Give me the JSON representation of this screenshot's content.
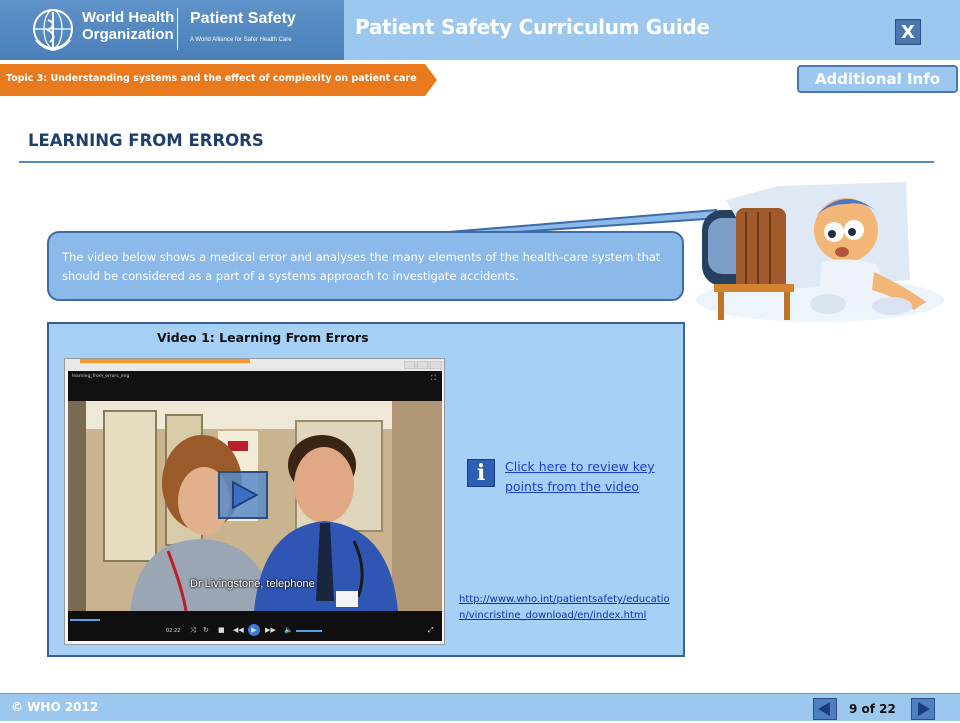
{
  "header": {
    "org_name": "World Health\nOrganization",
    "program_title": "Patient Safety",
    "program_subtitle": "A World Alliance for Safer Health Care",
    "app_title": "Patient Safety Curriculum Guide",
    "close_label": "X"
  },
  "topic": {
    "label": "Topic 3: Understanding systems and the effect of complexity on patient care"
  },
  "additional_info_label": "Additional Info",
  "page": {
    "title": "LEARNING FROM ERRORS",
    "intro": "The video below shows a medical error and analyses the many elements of the health-care system that should be considered as a part of a systems  approach to  investigate accidents."
  },
  "video": {
    "title": "Video 1: Learning From Errors",
    "filename": "learning_from_errors_eng",
    "subtitle": "Dr Livingstone, telephone",
    "time": "02:22",
    "progress": 0.08
  },
  "links": {
    "key_points": "Click here to review key points from the video",
    "url": "http://www.who.int/patientsafety/education/vincristine_download/en/index.html"
  },
  "footer": {
    "copyright": "© WHO 2012",
    "page_indicator": "9 of 22"
  },
  "icons": {
    "info": "info-icon",
    "prev": "arrow-left-icon",
    "next": "arrow-right-icon",
    "play": "play-icon"
  },
  "colors": {
    "header_bg": "#9cc7ee",
    "logo_bg": "#4a7fb8",
    "topic_orange": "#e8791c",
    "title_text": "#1f3f6b",
    "panel_bg": "#a7d0f7",
    "link": "#1b3fc8"
  }
}
